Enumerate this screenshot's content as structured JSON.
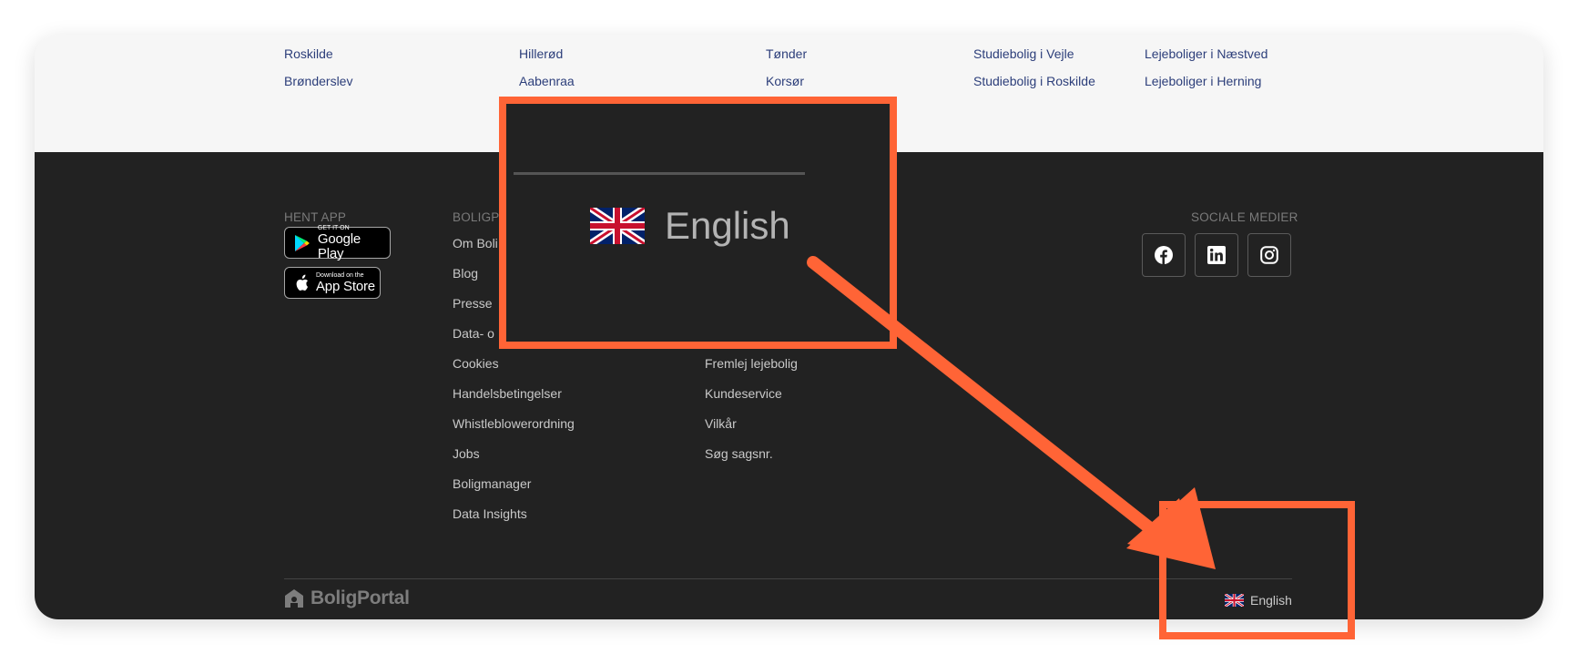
{
  "cities": {
    "columns": [
      [
        "Roskilde",
        "Brønderslev"
      ],
      [
        "Hillerød",
        "Aabenraa"
      ],
      [
        "Tønder",
        "Korsør"
      ],
      [
        "Studiebolig i Vejle",
        "Studiebolig i Roskilde"
      ],
      [
        "Lejeboliger i Næstved",
        "Lejeboliger i Herning"
      ]
    ]
  },
  "footer": {
    "app_heading": "HENT APP",
    "google_play": {
      "small": "GET IT ON",
      "big": "Google Play"
    },
    "app_store": {
      "small": "Download on the",
      "big": "App Store"
    },
    "boligportal_heading": "BOLIGP",
    "boligportal_links": [
      "Om Boli",
      "Blog",
      "Presse",
      "Data- o",
      "Cookies",
      "Handelsbetingelser",
      "Whistleblowerordning",
      "Jobs",
      "Boligmanager",
      "Data Insights"
    ],
    "service_links": [
      "Fremlej lejebolig",
      "Kundeservice",
      "Vilkår",
      "Søg sagsnr."
    ],
    "social_heading": "SOCIALE MEDIER",
    "social_icons": [
      "facebook-icon",
      "linkedin-icon",
      "instagram-icon"
    ],
    "logo_text": "BoligPortal",
    "language_label": "English"
  },
  "zoom": {
    "language_label": "English"
  },
  "colors": {
    "accent": "#ff6436",
    "footer_bg": "#222222",
    "link_blue": "#2c3e7a"
  }
}
